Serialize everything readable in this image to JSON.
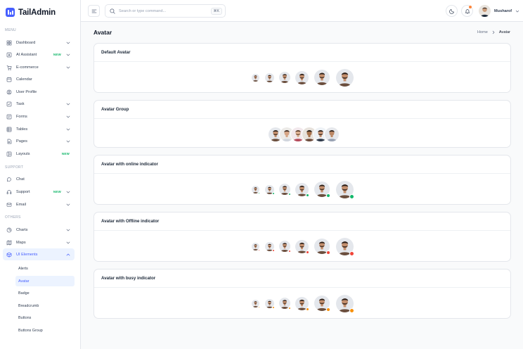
{
  "brand": {
    "name": "TailAdmin"
  },
  "sidebar": {
    "sections": [
      "MENU",
      "SUPPORT",
      "OTHERS"
    ],
    "items": [
      {
        "label": "Dashboard",
        "icon": "grid-icon",
        "chevron": true,
        "badge": ""
      },
      {
        "label": "AI Assistant",
        "icon": "ai-icon",
        "chevron": true,
        "badge": "NEW"
      },
      {
        "label": "E-commerce",
        "icon": "cart-icon",
        "chevron": true,
        "badge": ""
      },
      {
        "label": "Calendar",
        "icon": "calendar-icon",
        "chevron": false,
        "badge": ""
      },
      {
        "label": "User Profile",
        "icon": "user-icon",
        "chevron": false,
        "badge": ""
      },
      {
        "label": "Task",
        "icon": "task-icon",
        "chevron": true,
        "badge": ""
      },
      {
        "label": "Forms",
        "icon": "forms-icon",
        "chevron": true,
        "badge": ""
      },
      {
        "label": "Tables",
        "icon": "table-icon",
        "chevron": true,
        "badge": ""
      },
      {
        "label": "Pages",
        "icon": "pages-icon",
        "chevron": true,
        "badge": ""
      },
      {
        "label": "Layouts",
        "icon": "layout-icon",
        "chevron": false,
        "badge": "NEW"
      },
      {
        "label": "Chat",
        "icon": "chat-icon",
        "chevron": false,
        "badge": ""
      },
      {
        "label": "Support",
        "icon": "headset-icon",
        "chevron": true,
        "badge": "NEW"
      },
      {
        "label": "Email",
        "icon": "mail-icon",
        "chevron": true,
        "badge": ""
      },
      {
        "label": "Charts",
        "icon": "pie-chart-icon",
        "chevron": true,
        "badge": ""
      },
      {
        "label": "Maps",
        "icon": "map-icon",
        "chevron": true,
        "badge": ""
      },
      {
        "label": "UI Elements",
        "icon": "cube-icon",
        "chevron": true,
        "badge": ""
      }
    ],
    "ui_elements_subitems": [
      "Alerts",
      "Avatar",
      "Badge",
      "Breadcrumb",
      "Buttons",
      "Buttons Group"
    ],
    "active_item": "UI Elements",
    "active_subitem": "Avatar"
  },
  "header": {
    "search_placeholder": "Search or type command...",
    "shortcut": "⌘K",
    "user_name": "Musharof"
  },
  "page": {
    "title": "Avatar",
    "breadcrumb": {
      "home": "Home",
      "current": "Avatar"
    }
  },
  "cards": [
    {
      "title": "Default Avatar",
      "type": "sizes",
      "indicator": "none"
    },
    {
      "title": "Avatar Group",
      "type": "group",
      "indicator": "none"
    },
    {
      "title": "Avatar with online indicator",
      "type": "sizes",
      "indicator": "online"
    },
    {
      "title": "Avatar with Offline indicator",
      "type": "sizes",
      "indicator": "offline"
    },
    {
      "title": "Avatar with busy indicator",
      "type": "sizes",
      "indicator": "busy"
    }
  ],
  "colors": {
    "accent": "#465fff",
    "online": "#12b76a",
    "offline": "#f04438",
    "busy": "#f79009",
    "badge_new": "#12b76a",
    "notification": "#fd853a"
  }
}
